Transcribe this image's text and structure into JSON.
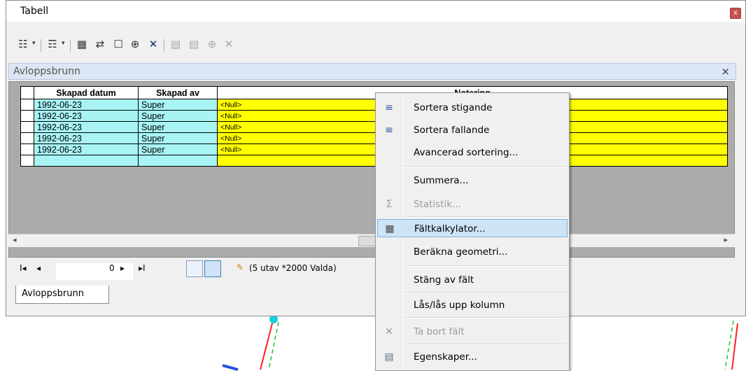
{
  "window": {
    "title": "Tabell",
    "close_glyph": "x"
  },
  "toolbar": {
    "icons": [
      "table-options-icon",
      "related-tables-icon",
      "select-by-attributes-icon",
      "switch-selection-icon",
      "clear-selection-icon",
      "zoom-to-selected-icon",
      "delete-selected-icon",
      "copy-icon",
      "paste-icon",
      "add-field-icon",
      "delete-icon"
    ]
  },
  "panel": {
    "title": "Avloppsbrunn",
    "close_glyph": "×"
  },
  "grid": {
    "headers": [
      "Skapad datum",
      "Skapad av",
      "Notering"
    ],
    "rows": [
      {
        "date": "1992-06-23",
        "by": "Super",
        "note": "<Null>"
      },
      {
        "date": "1992-06-23",
        "by": "Super",
        "note": "<Null>"
      },
      {
        "date": "1992-06-23",
        "by": "Super",
        "note": "<Null>"
      },
      {
        "date": "1992-06-23",
        "by": "Super",
        "note": "<Null>"
      },
      {
        "date": "1992-06-23",
        "by": "Super",
        "note": "<Null>"
      }
    ]
  },
  "nav": {
    "first": "I◂",
    "prev": "◂",
    "record": "0",
    "next": "▸",
    "last": "▸I",
    "status": "(5 utav *2000 Valda)"
  },
  "tab": {
    "label": "Avloppsbrunn"
  },
  "context_menu": {
    "items": [
      {
        "label": "Sortera stigande",
        "icon": "sort-ascending-icon",
        "glyph": "≡",
        "disabled": false
      },
      {
        "label": "Sortera fallande",
        "icon": "sort-descending-icon",
        "glyph": "≡",
        "disabled": false
      },
      {
        "label": "Avancerad sortering...",
        "icon": "",
        "glyph": "",
        "disabled": false
      },
      {
        "label": "Summera...",
        "icon": "",
        "glyph": "",
        "disabled": false
      },
      {
        "label": "Statistik...",
        "icon": "sigma-icon",
        "glyph": "Σ",
        "disabled": true
      },
      {
        "label": "Fältkalkylator...",
        "icon": "calculator-icon",
        "glyph": "▦",
        "disabled": false,
        "hover": true
      },
      {
        "label": "Beräkna geometri...",
        "icon": "",
        "glyph": "",
        "disabled": false
      },
      {
        "label": "Stäng av fält",
        "icon": "",
        "glyph": "",
        "disabled": false
      },
      {
        "label": "Lås/lås upp kolumn",
        "icon": "",
        "glyph": "",
        "disabled": false
      },
      {
        "label": "Ta bort fält",
        "icon": "delete-field-icon",
        "glyph": "✕",
        "disabled": true
      },
      {
        "label": "Egenskaper...",
        "icon": "properties-icon",
        "glyph": "▤",
        "disabled": false
      }
    ]
  },
  "colors": {
    "cyan_cell": "#a8f4f4",
    "yellow_cell": "#ffff00",
    "menu_hover": "#cde4f7"
  }
}
